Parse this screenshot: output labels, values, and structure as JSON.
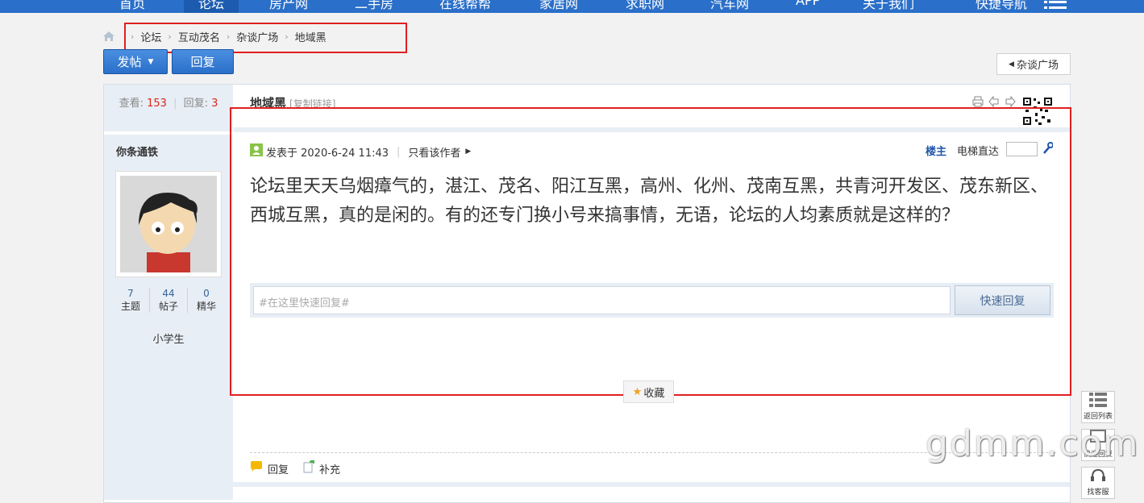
{
  "topnav": {
    "items": [
      "首页",
      "论坛",
      "房产网",
      "二手房",
      "在线帮帮",
      "家居网",
      "求职网",
      "汽车网",
      "APP",
      "关于我们",
      "快捷导航"
    ]
  },
  "breadcrumb": [
    "论坛",
    "互动茂名",
    "杂谈广场",
    "地域黑"
  ],
  "buttons": {
    "post": "发帖",
    "reply": "回复",
    "back": "杂谈广场"
  },
  "stats": {
    "views_label": "查看:",
    "views": "153",
    "replies_label": "回复:",
    "replies": "3"
  },
  "author": {
    "name": "你条通铁",
    "counts": [
      {
        "n": "7",
        "label": "主题"
      },
      {
        "n": "44",
        "label": "帖子"
      },
      {
        "n": "0",
        "label": "精华"
      }
    ],
    "rank": "小学生"
  },
  "thread": {
    "title": "地域黑",
    "copy_link": "[复制链接]"
  },
  "post": {
    "meta": "发表于 2020-6-24 11:43",
    "only_author": "只看该作者",
    "floor": "楼主",
    "lift": "电梯直达",
    "content": "论坛里天天乌烟瘴气的，湛江、茂名、阳江互黑，高州、化州、茂南互黑，共青河开发区、茂东新区、西城互黑，真的是闲的。有的还专门换小号来搞事情，无语，论坛的人均素质就是这样的？"
  },
  "quick_reply": {
    "placeholder": "#在这里快速回复#",
    "button": "快速回复"
  },
  "favorite": "收藏",
  "actions": {
    "reply": "回复",
    "supplement": "补充"
  },
  "side": [
    {
      "label": "返回列表"
    },
    {
      "label": "快速回复"
    },
    {
      "label": "找客服"
    }
  ],
  "watermark": "gdmm.com",
  "colors": {
    "nav": "#2a6fc9",
    "highlight": "#e02020",
    "sidebar": "#e8eef5"
  }
}
